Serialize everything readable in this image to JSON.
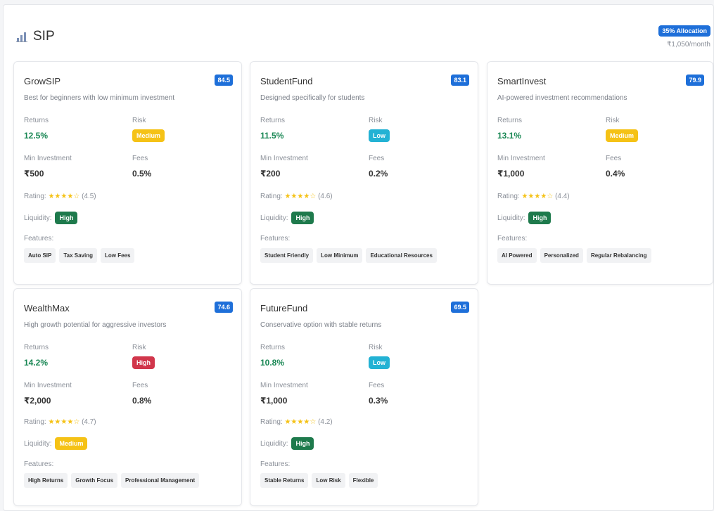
{
  "section": {
    "title": "SIP",
    "icon": "bar-chart-icon",
    "allocation_badge": "35% Allocation",
    "allocation_amount": "₹1,050/month"
  },
  "colors": {
    "primary": "#1e6fd9",
    "returns_green": "#198754",
    "risk_medium": "#f5c216",
    "risk_low": "#23b2d4",
    "risk_high": "#d1364b",
    "liquidity_high": "#1e7a4c"
  },
  "labels": {
    "returns": "Returns",
    "risk": "Risk",
    "min_investment": "Min Investment",
    "fees": "Fees",
    "rating": "Rating:",
    "liquidity": "Liquidity:",
    "features": "Features:"
  },
  "funds": [
    {
      "name": "GrowSIP",
      "score": "84.5",
      "description": "Best for beginners with low minimum investment",
      "returns": "12.5%",
      "risk": "Medium",
      "min_investment": "₹500",
      "fees": "0.5%",
      "stars": "★★★★☆",
      "rating": "(4.5)",
      "liquidity": "High",
      "features": [
        "Auto SIP",
        "Tax Saving",
        "Low Fees"
      ]
    },
    {
      "name": "StudentFund",
      "score": "83.1",
      "description": "Designed specifically for students",
      "returns": "11.5%",
      "risk": "Low",
      "min_investment": "₹200",
      "fees": "0.2%",
      "stars": "★★★★☆",
      "rating": "(4.6)",
      "liquidity": "High",
      "features": [
        "Student Friendly",
        "Low Minimum",
        "Educational Resources"
      ]
    },
    {
      "name": "SmartInvest",
      "score": "79.9",
      "description": "AI-powered investment recommendations",
      "returns": "13.1%",
      "risk": "Medium",
      "min_investment": "₹1,000",
      "fees": "0.4%",
      "stars": "★★★★☆",
      "rating": "(4.4)",
      "liquidity": "High",
      "features": [
        "AI Powered",
        "Personalized",
        "Regular Rebalancing"
      ]
    },
    {
      "name": "WealthMax",
      "score": "74.6",
      "description": "High growth potential for aggressive investors",
      "returns": "14.2%",
      "risk": "High",
      "min_investment": "₹2,000",
      "fees": "0.8%",
      "stars": "★★★★☆",
      "rating": "(4.7)",
      "liquidity": "Medium",
      "features": [
        "High Returns",
        "Growth Focus",
        "Professional Management"
      ]
    },
    {
      "name": "FutureFund",
      "score": "69.5",
      "description": "Conservative option with stable returns",
      "returns": "10.8%",
      "risk": "Low",
      "min_investment": "₹1,000",
      "fees": "0.3%",
      "stars": "★★★★☆",
      "rating": "(4.2)",
      "liquidity": "High",
      "features": [
        "Stable Returns",
        "Low Risk",
        "Flexible"
      ]
    }
  ]
}
